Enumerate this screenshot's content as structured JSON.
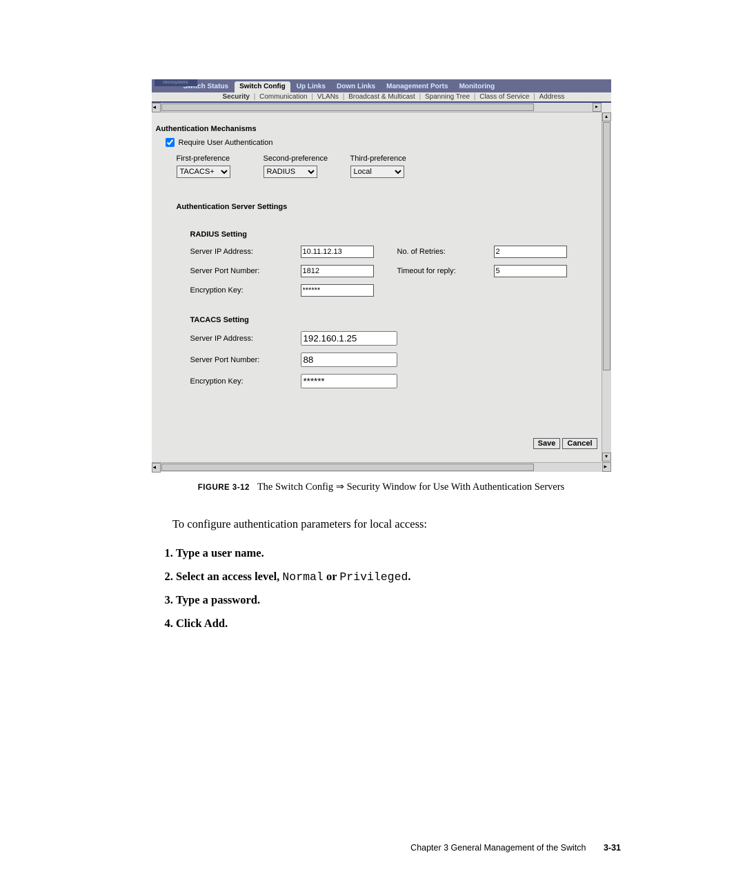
{
  "top_tabs": {
    "switch_status": "Switch Status",
    "switch_config": "Switch Config",
    "up_links": "Up Links",
    "down_links": "Down Links",
    "management_ports": "Management Ports",
    "monitoring": "Monitoring"
  },
  "sub_tabs": {
    "security": "Security",
    "communication": "Communication",
    "vlans": "VLANs",
    "broadcast": "Broadcast & Multicast",
    "spanning": "Spanning Tree",
    "cos": "Class of Service",
    "address": "Address"
  },
  "auth_mech_heading": "Authentication Mechanisms",
  "require_user_auth": "Require User Authentication",
  "prefs": {
    "first_label": "First-preference",
    "second_label": "Second-preference",
    "third_label": "Third-preference",
    "first_value": "TACACS+",
    "second_value": "RADIUS",
    "third_value": "Local"
  },
  "server_settings_heading": "Authentication Server Settings",
  "radius": {
    "heading": "RADIUS Setting",
    "server_ip_label": "Server IP Address:",
    "server_ip": "10.11.12.13",
    "retries_label": "No. of Retries:",
    "retries": "2",
    "port_label": "Server Port Number:",
    "port": "1812",
    "timeout_label": "Timeout for reply:",
    "timeout": "5",
    "key_label": "Encryption Key:",
    "key": "******"
  },
  "tacacs": {
    "heading": "TACACS Setting",
    "server_ip_label": "Server IP Address:",
    "server_ip": "192.160.1.25",
    "port_label": "Server Port Number:",
    "port": "88",
    "key_label": "Encryption Key:",
    "key": "******"
  },
  "buttons": {
    "save": "Save",
    "cancel": "Cancel"
  },
  "caption": {
    "label": "FIGURE 3-12",
    "text": "The Switch Config ⇒ Security Window for Use With Authentication Servers"
  },
  "para_intro": "To configure authentication parameters for local access:",
  "steps": {
    "s1": "Type a user name.",
    "s2a": "Select an access level, ",
    "s2_normal": "Normal",
    "s2_or": " or ",
    "s2_priv": "Privileged",
    "s2_dot": ".",
    "s3": "Type a password.",
    "s4": "Click Add."
  },
  "footer": {
    "chapter": "Chapter 3    General Management of the Switch",
    "page": "3-31"
  }
}
